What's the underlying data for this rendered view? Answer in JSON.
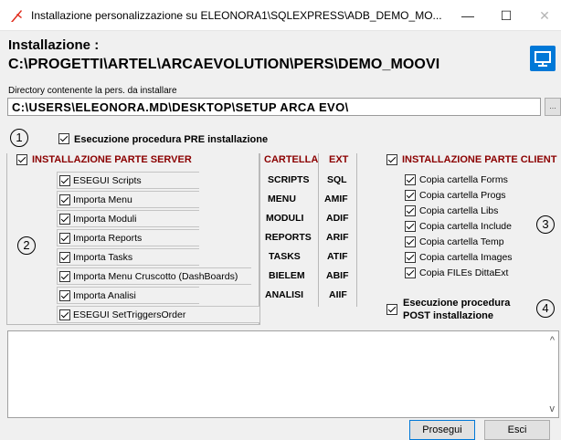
{
  "window": {
    "title": "Installazione personalizzazione su ELEONORA1\\SQLEXPRESS\\ADB_DEMO_MO...",
    "minimize_glyph": "—",
    "maximize_glyph": "☐",
    "close_glyph": "✕"
  },
  "header": {
    "label": "Installazione :",
    "path": "C:\\PROGETTI\\ARTEL\\ARCAEVOLUTION\\PERS\\DEMO_MOOVI",
    "monitor_icon": "monitor-icon"
  },
  "directory": {
    "label": "Directory contenente la pers. da installare",
    "value": "C:\\USERS\\ELEONORA.MD\\DESKTOP\\SETUP ARCA EVO\\",
    "browse_label": "..."
  },
  "markers": {
    "m1": "1",
    "m2": "2",
    "m3": "3",
    "m4": "4"
  },
  "pre": {
    "label": "Esecuzione procedura PRE installazione",
    "checked": true
  },
  "server": {
    "title": "INSTALLAZIONE PARTE SERVER",
    "items": [
      {
        "label": "ESEGUI Scripts",
        "checked": true
      },
      {
        "label": "Importa Menu",
        "checked": true
      },
      {
        "label": "Importa Moduli",
        "checked": true
      },
      {
        "label": "Importa Reports",
        "checked": true
      },
      {
        "label": "Importa Tasks",
        "checked": true
      },
      {
        "label": "Importa Menu Cruscotto (DashBoards)",
        "checked": true
      },
      {
        "label": "Importa Analisi",
        "checked": true
      },
      {
        "label": "ESEGUI SetTriggersOrder",
        "checked": true
      }
    ]
  },
  "table": {
    "head_cartella": "CARTELLA",
    "head_ext": "EXT",
    "rows": [
      {
        "cartella": "SCRIPTS",
        "ext": "SQL"
      },
      {
        "cartella": "MENU",
        "ext": "AMIF"
      },
      {
        "cartella": "MODULI",
        "ext": "ADIF"
      },
      {
        "cartella": "REPORTS",
        "ext": "ARIF"
      },
      {
        "cartella": "TASKS",
        "ext": "ATIF"
      },
      {
        "cartella": "BIELEM",
        "ext": "ABIF"
      },
      {
        "cartella": "ANALISI",
        "ext": "AIIF"
      }
    ]
  },
  "client": {
    "title": "INSTALLAZIONE PARTE CLIENT",
    "items": [
      {
        "label": "Copia cartella Forms",
        "checked": true
      },
      {
        "label": "Copia cartella Progs",
        "checked": true
      },
      {
        "label": "Copia cartella Libs",
        "checked": true
      },
      {
        "label": "Copia cartella Include",
        "checked": true
      },
      {
        "label": "Copia cartella Temp",
        "checked": true
      },
      {
        "label": "Copia cartella Images",
        "checked": true
      },
      {
        "label": "Copia FILEs DittaExt",
        "checked": true
      }
    ]
  },
  "post": {
    "line1": "Esecuzione procedura",
    "line2": "POST installazione",
    "checked": true
  },
  "log": {
    "scroll_up": "^",
    "scroll_down": "v"
  },
  "buttons": {
    "prosegui": "Prosegui",
    "esci": "Esci"
  },
  "colors": {
    "accent": "#0078d7",
    "section_title": "#8b0000",
    "logo": "#e0291a"
  }
}
